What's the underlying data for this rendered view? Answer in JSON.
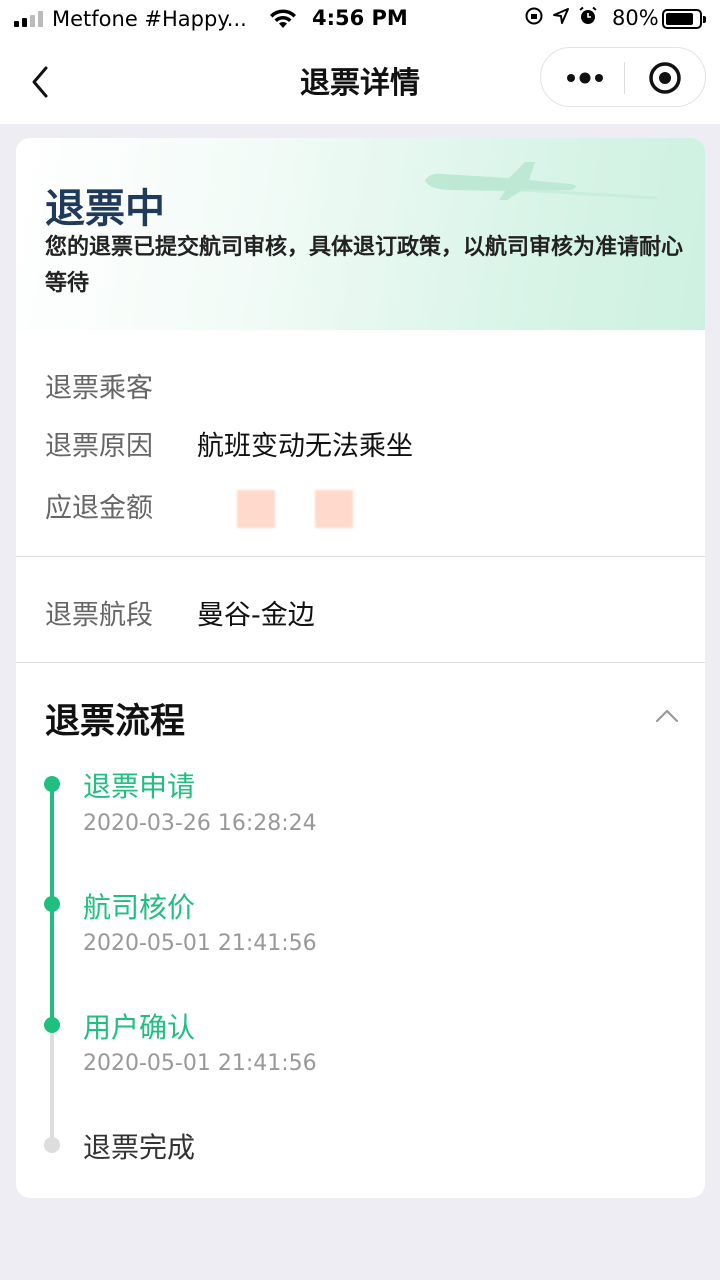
{
  "status_bar": {
    "carrier": "Metfone #Happy...",
    "time": "4:56 PM",
    "battery": "80%"
  },
  "nav": {
    "title": "退票详情",
    "icons": [
      "back-chevron-icon",
      "more-dots-icon",
      "close-target-icon"
    ]
  },
  "status": {
    "title": "退票中",
    "description": "您的退票已提交航司审核，具体退订政策，以航司审核为准请耐心等待"
  },
  "info": {
    "passenger_label": "退票乘客",
    "passenger_value": "",
    "reason_label": "退票原因",
    "reason_value": "航班变动无法乘坐",
    "amount_label": "应退金额",
    "segment_label": "退票航段",
    "segment_value": "曼谷-金边"
  },
  "process": {
    "title": "退票流程",
    "steps": [
      {
        "title": "退票申请",
        "time": "2020-03-26 16:28:24",
        "done": true
      },
      {
        "title": "航司核价",
        "time": "2020-05-01 21:41:56",
        "done": true
      },
      {
        "title": "用户确认",
        "time": "2020-05-01 21:41:56",
        "done": true
      },
      {
        "title": "退票完成",
        "time": "",
        "done": false
      }
    ]
  },
  "colors": {
    "accent": "#1fbf80",
    "pending": "#dddddd",
    "status_title": "#1f3a5a",
    "background": "#eeedf3"
  }
}
